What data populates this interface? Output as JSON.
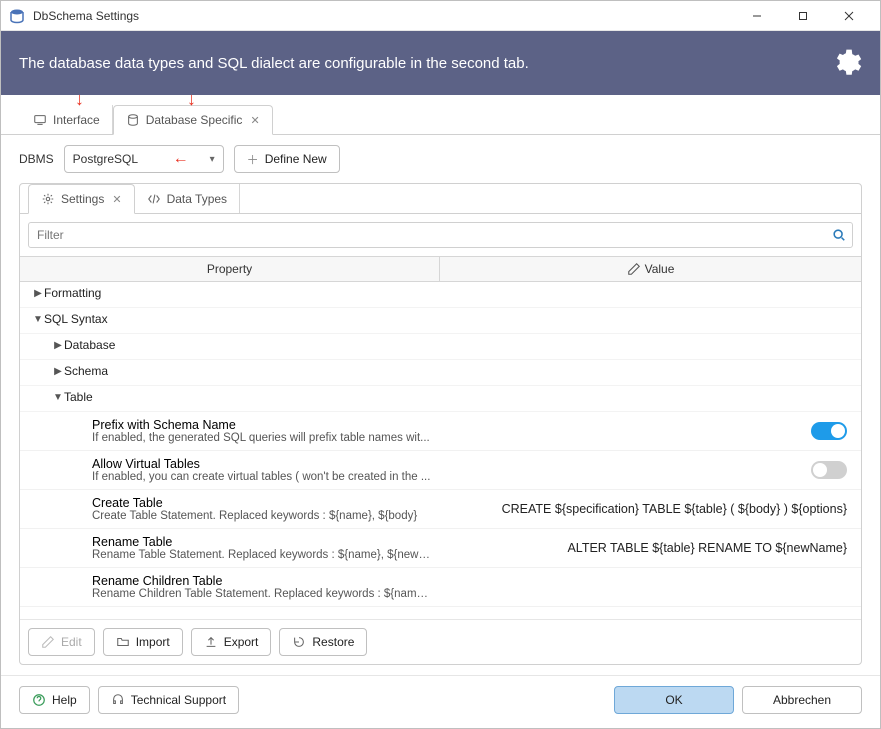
{
  "window": {
    "title": "DbSchema Settings"
  },
  "banner": {
    "message": "The database data types and SQL dialect are configurable in the second tab."
  },
  "top_tabs": {
    "interface": "Interface",
    "db_specific": "Database Specific"
  },
  "dbms": {
    "label": "DBMS",
    "selected": "PostgreSQL",
    "define_new": "Define New"
  },
  "sub_tabs": {
    "settings": "Settings",
    "data_types": "Data Types"
  },
  "filter": {
    "placeholder": "Filter"
  },
  "columns": {
    "property": "Property",
    "value": "Value"
  },
  "tree": {
    "formatting": "Formatting",
    "sql_syntax": "SQL Syntax",
    "database": "Database",
    "schema": "Schema",
    "table": "Table",
    "rows": {
      "prefix": {
        "title": "Prefix with Schema Name",
        "desc": "If enabled, the generated SQL queries will prefix table names wit...",
        "value_on": true
      },
      "virtual": {
        "title": "Allow Virtual Tables",
        "desc": "If enabled, you can create virtual tables ( won't be created in the ...",
        "value_on": false
      },
      "create": {
        "title": "Create Table",
        "desc": "Create Table Statement. Replaced keywords : ${name}, ${body}",
        "value": "CREATE ${specification} TABLE ${table} ( ${body} ) ${options}"
      },
      "rename": {
        "title": "Rename Table",
        "desc": "Rename Table Statement. Replaced keywords : ${name}, ${newNa...",
        "value": "ALTER TABLE ${table} RENAME TO ${newName}"
      },
      "rename_children": {
        "title": "Rename Children Table",
        "desc": "Rename Children Table Statement. Replaced keywords : ${name}, ...",
        "value": ""
      }
    }
  },
  "toolbar": {
    "edit": "Edit",
    "import": "Import",
    "export": "Export",
    "restore": "Restore"
  },
  "footer": {
    "help": "Help",
    "support": "Technical Support",
    "ok": "OK",
    "cancel": "Abbrechen"
  }
}
